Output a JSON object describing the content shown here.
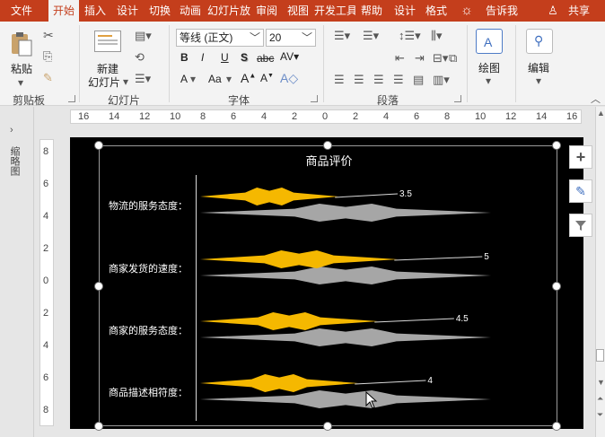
{
  "tabs": [
    "文件",
    "开始",
    "插入",
    "设计",
    "切换",
    "动画",
    "幻灯片放映",
    "审阅",
    "视图",
    "开发工具",
    "帮助",
    "设计",
    "格式"
  ],
  "active_tab": "开始",
  "tell_me": "告诉我",
  "share": "共享",
  "ribbon": {
    "clipboard": {
      "paste_label": "粘贴",
      "group_label": "剪贴板"
    },
    "slides": {
      "new_slide_label": "新建",
      "new_slide_label2": "幻灯片",
      "group_label": "幻灯片"
    },
    "font": {
      "font_name": "等线 (正文)",
      "font_size": "20",
      "group_label": "字体",
      "bold": "B",
      "italic": "I",
      "underline": "U",
      "shadow": "S",
      "strike": "abc",
      "font_color": "A",
      "change_case": "Aa"
    },
    "paragraph": {
      "group_label": "段落"
    },
    "drawing": {
      "label": "绘图"
    },
    "editing": {
      "label": "编辑"
    }
  },
  "left_pane": {
    "label": "缩略图"
  },
  "ruler": {
    "h_ticks": [
      "16",
      "14",
      "12",
      "10",
      "8",
      "6",
      "4",
      "2",
      "0",
      "2",
      "4",
      "6",
      "8",
      "10",
      "12",
      "14",
      "16"
    ],
    "v_ticks": [
      "8",
      "6",
      "4",
      "2",
      "0",
      "2",
      "4",
      "6",
      "8"
    ]
  },
  "colors": {
    "tab_bar": "#c43e1c",
    "ribbon_bg": "#f3f3f3",
    "slide_bg": "#000000",
    "series_orange": "#f5b800",
    "series_gray": "#a6a6a6"
  },
  "chart_data": {
    "type": "bar",
    "title": "商品评价",
    "categories": [
      "物流的服务态度：",
      "商家发货的速度：",
      "商家的服务态度：",
      "商品描述相符度："
    ],
    "series": [
      {
        "values": [
          3.5,
          5,
          4.5,
          4
        ],
        "color": "#f5b800",
        "labels": [
          "3.5",
          "5",
          "4.5",
          "4"
        ]
      },
      {
        "values": [
          5,
          5,
          5,
          5
        ],
        "color": "#a6a6a6"
      }
    ],
    "xlim": [
      0,
      5
    ]
  }
}
